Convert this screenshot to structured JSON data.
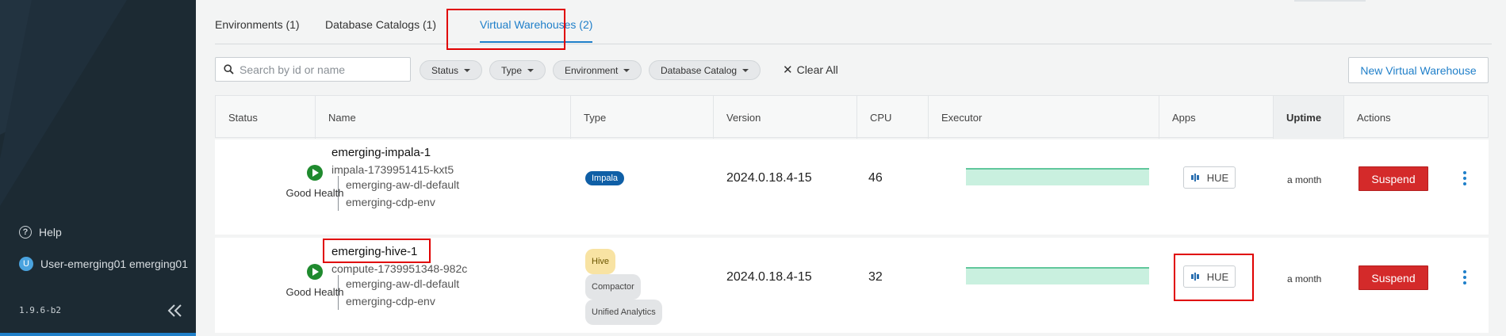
{
  "sidebar": {
    "help_label": "Help",
    "user_initial": "U",
    "user_label": "User-emerging01 emerging01",
    "version": "1.9.6-b2"
  },
  "tabs": [
    {
      "label": "Environments (1)"
    },
    {
      "label": "Database Catalogs (1)"
    },
    {
      "label": "Virtual Warehouses (2)",
      "active": true
    }
  ],
  "filters": {
    "search_placeholder": "Search by id or name",
    "chips": [
      "Status",
      "Type",
      "Environment",
      "Database Catalog"
    ],
    "clear_label": "Clear All",
    "new_button": "New Virtual Warehouse"
  },
  "table": {
    "columns": [
      "Status",
      "Name",
      "Type",
      "Version",
      "CPU",
      "Executor",
      "Apps",
      "Uptime",
      "Actions"
    ],
    "rows": [
      {
        "health": "Good Health",
        "name": "emerging-impala-1",
        "id": "impala-1739951415-kxt5",
        "tree": [
          "emerging-aw-dl-default",
          "emerging-cdp-env"
        ],
        "types": [
          "Impala"
        ],
        "version": "2024.0.18.4-15",
        "cpu": "46",
        "app": "HUE",
        "uptime": "a month",
        "action": "Suspend"
      },
      {
        "health": "Good Health",
        "name": "emerging-hive-1",
        "id": "compute-1739951348-982c",
        "tree": [
          "emerging-aw-dl-default",
          "emerging-cdp-env"
        ],
        "types": [
          "Hive",
          "Compactor",
          "Unified Analytics"
        ],
        "version": "2024.0.18.4-15",
        "cpu": "32",
        "app": "HUE",
        "uptime": "a month",
        "action": "Suspend"
      }
    ]
  },
  "colors": {
    "accent": "#1f7fc9",
    "sidebar_bg": "#1c2a33",
    "healthy": "#1f8a2e",
    "suspend": "#d42a2a",
    "highlight": "#e00000"
  }
}
